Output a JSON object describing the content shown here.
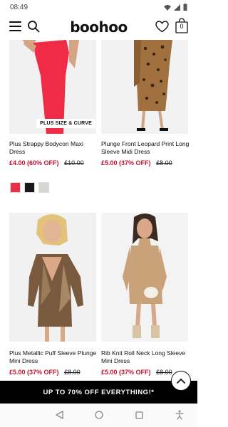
{
  "status_bar": {
    "time": "08:49"
  },
  "header": {
    "logo": "boohoo",
    "bag_count": "0"
  },
  "products": [
    {
      "name": "Plus Strappy Bodycon Maxi Dress",
      "sale_price": "£4.00",
      "discount": "(60% OFF)",
      "was_price": "£10.00",
      "badge": "PLUS SIZE & CURVE",
      "swatches": [
        "#e8304a",
        "#1a1a1a",
        "#d8d6d2"
      ]
    },
    {
      "name": "Plunge Front Leopard Print Long Sleeve Midi Dress",
      "sale_price": "£5.00",
      "discount": "(37% OFF)",
      "was_price": "£8.00"
    },
    {
      "name": "Plus Metallic Puff Sleeve Plunge Mini Dress",
      "sale_price": "£5.00",
      "discount": "(37% OFF)",
      "was_price": "£8.00"
    },
    {
      "name": "Rib Knit Roll Neck Long Sleeve Mini Dress",
      "sale_price": "£5.00",
      "discount": "(37% OFF)",
      "was_price": "£8.00"
    }
  ],
  "promo": {
    "text": "UP TO 70% OFF EVERYTHING!*"
  },
  "colors": {
    "sale": "#c8102e",
    "banner": "#000000"
  }
}
